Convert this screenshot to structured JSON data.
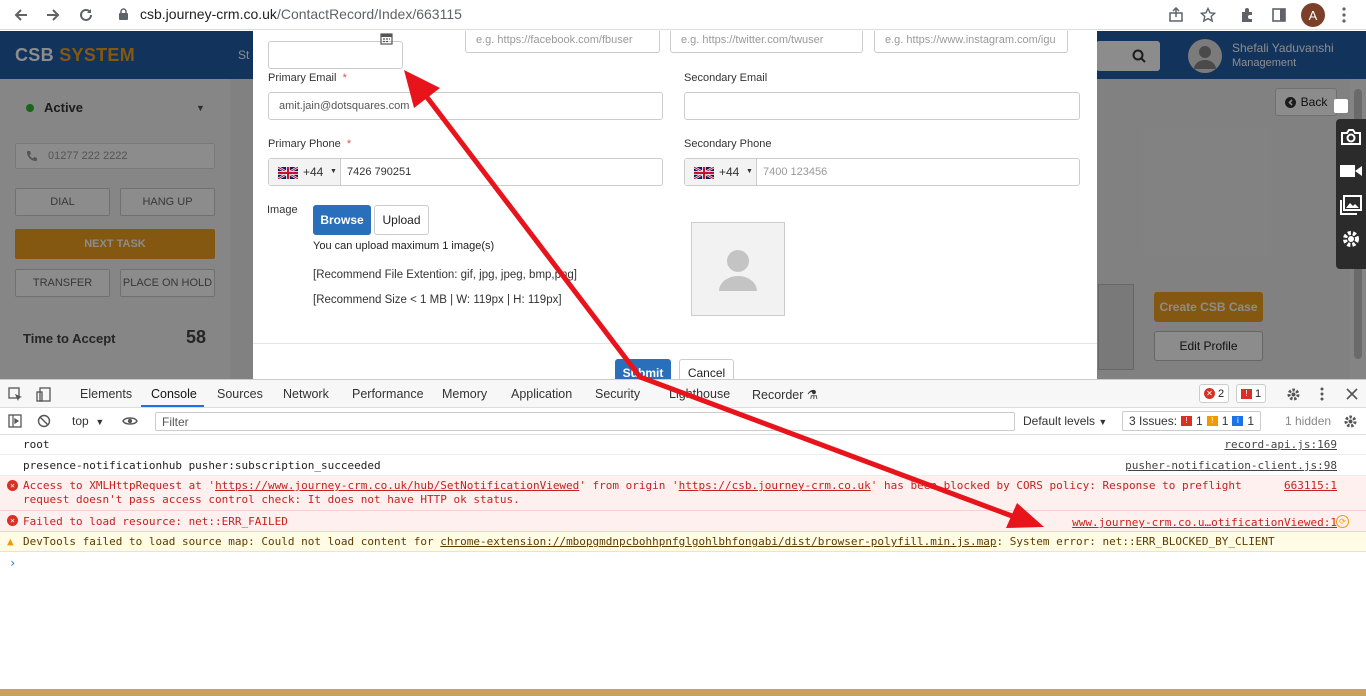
{
  "browser": {
    "url_host": "csb.journey-crm.co.uk",
    "url_path": "/ContactRecord/Index/663115",
    "profile_initial": "A"
  },
  "app": {
    "logo_main": "CSB",
    "logo_accent": "SYSTEM",
    "nav_partial": "St",
    "user_name": "Shefali Yaduvanshi",
    "user_role": "Management"
  },
  "left_panel": {
    "status": "Active",
    "phone_placeholder": "01277 222 2222",
    "dial": "DIAL",
    "hang_up": "HANG UP",
    "next_task": "NEXT TASK",
    "transfer": "TRANSFER",
    "place_on_hold": "PLACE ON HOLD",
    "time_to_accept_label": "Time to Accept",
    "time_to_accept_value": "58"
  },
  "right_panel": {
    "back": "Back",
    "create_case": "Create CSB Case",
    "edit_profile": "Edit Profile"
  },
  "modal": {
    "social_placeholders": [
      "e.g. https://facebook.com/fbuser",
      "e.g. https://twitter.com/twuser",
      "e.g. https://www.instagram.com/igu"
    ],
    "primary_email_label": "Primary Email",
    "primary_email_value": "amit.jain@dotsquares.com",
    "secondary_email_label": "Secondary Email",
    "secondary_email_value": "",
    "primary_phone_label": "Primary Phone",
    "primary_phone_code": "+44",
    "primary_phone_value": "7426 790251",
    "secondary_phone_label": "Secondary Phone",
    "secondary_phone_code": "+44",
    "secondary_phone_placeholder": "7400 123456",
    "required_mark": "*",
    "image_label": "Image",
    "browse": "Browse",
    "upload": "Upload",
    "upload_limit": "You can upload maximum 1 image(s)",
    "recommend_ext": "[Recommend File Extention: gif, jpg, jpeg, bmp,png]",
    "recommend_size": "[Recommend Size < 1 MB | W: 119px | H: 119px]",
    "submit": "Submit",
    "cancel": "Cancel"
  },
  "devtools": {
    "tabs": [
      "Elements",
      "Console",
      "Sources",
      "Network",
      "Performance",
      "Memory",
      "Application",
      "Security",
      "Lighthouse",
      "Recorder"
    ],
    "active_tab": "Console",
    "error_count": "2",
    "issue_count": "1",
    "context": "top",
    "filter_placeholder": "Filter",
    "levels": "Default levels",
    "issues_label": "3 Issues:",
    "issues_err": "1",
    "issues_warn": "1",
    "issues_info": "1",
    "hidden": "1 hidden",
    "console": [
      {
        "type": "log",
        "text": "root",
        "source": "record-api.js:169"
      },
      {
        "type": "log",
        "text": "presence-notificationhub pusher:subscription_succeeded",
        "source": "pusher-notification-client.js:98"
      },
      {
        "type": "error",
        "text_a": "Access to XMLHttpRequest at '",
        "link_a": "https://www.journey-crm.co.uk/hub/SetNotificationViewed",
        "text_b": "' from origin '",
        "link_b": "https://csb.journey-crm.co.uk",
        "text_c": "' has been blocked by CORS policy: Response to preflight",
        "text_d": "request doesn't pass access control check: It does not have HTTP ok status.",
        "source": "663115:1"
      },
      {
        "type": "error",
        "text": "Failed to load resource: net::ERR_FAILED",
        "source": "www.journey-crm.co.u…otificationViewed:1"
      },
      {
        "type": "warning",
        "text_a": "DevTools failed to load source map: Could not load content for ",
        "link_a": "chrome-extension://mbopgmdnpcbohhpnfglgohlbhfongabi/dist/browser-polyfill.min.js.map",
        "text_b": ": System error: net::ERR_BLOCKED_BY_CLIENT"
      }
    ]
  },
  "colors": {
    "header_blue": "#1f5ea8",
    "accent_orange": "#f0a020",
    "annotation_red": "#e8141c",
    "error_red": "#c5221f"
  }
}
